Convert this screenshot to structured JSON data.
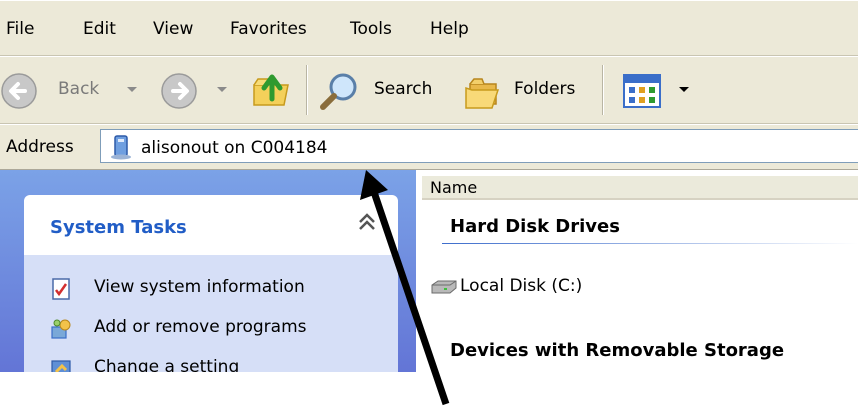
{
  "menu": [
    "File",
    "Edit",
    "View",
    "Favorites",
    "Tools",
    "Help"
  ],
  "toolbar": {
    "back_label": "Back",
    "search_label": "Search",
    "folders_label": "Folders"
  },
  "address": {
    "label": "Address",
    "value": "alisonout on C004184"
  },
  "task_pane": {
    "title": "System Tasks",
    "items": [
      "View system information",
      "Add or remove programs",
      "Change a setting"
    ]
  },
  "content": {
    "column_header": "Name",
    "groups": [
      "Hard Disk Drives",
      "Devices with Removable Storage"
    ],
    "drive_label": "Local Disk (C:)"
  },
  "colors": {
    "panel_title": "#215dc6",
    "pane_gradient_top": "#7ba2e7",
    "pane_gradient_bottom": "#6375d6",
    "annotation_arrow": "#000000"
  }
}
